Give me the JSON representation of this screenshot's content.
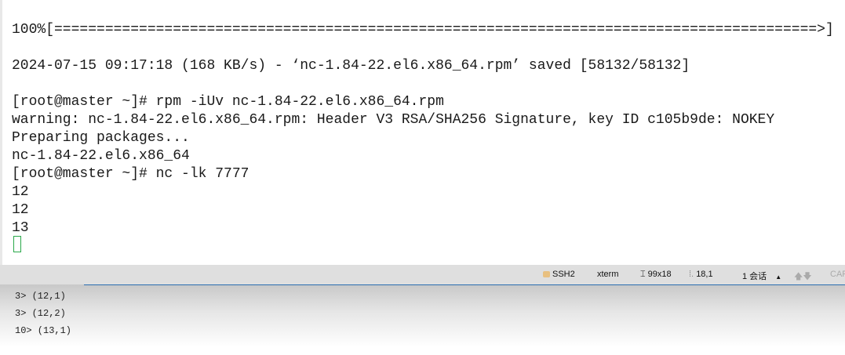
{
  "terminal": {
    "lines": [
      "100%[==========================================================================================>]",
      "2024-07-15 09:17:18 (168 KB/s) - ‘nc-1.84-22.el6.x86_64.rpm’ saved [58132/58132]",
      "[root@master ~]# rpm -iUv nc-1.84-22.el6.x86_64.rpm",
      "warning: nc-1.84-22.el6.x86_64.rpm: Header V3 RSA/SHA256 Signature, key ID c105b9de: NOKEY",
      "Preparing packages...",
      "nc-1.84-22.el6.x86_64",
      "[root@master ~]# nc -lk 7777",
      "12",
      "12",
      "13"
    ]
  },
  "status": {
    "protocol": "SSH2",
    "term_type": "xterm",
    "size": "99x18",
    "cursor_pos": "18,1",
    "sessions": "1 会话",
    "caps": "CAP"
  },
  "output": {
    "lines": [
      "3> (12,1)",
      "3> (12,2)",
      "10> (13,1)"
    ]
  }
}
